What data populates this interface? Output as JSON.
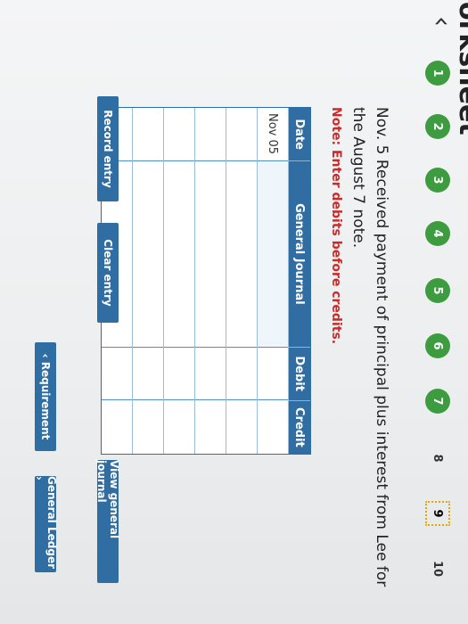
{
  "header": {
    "title": "Worksheet"
  },
  "nav": {
    "prev_icon": "‹",
    "steps": [
      {
        "label": "1",
        "state": "done"
      },
      {
        "label": "2",
        "state": "done"
      },
      {
        "label": "3",
        "state": "done"
      },
      {
        "label": "4",
        "state": "done"
      },
      {
        "label": "5",
        "state": "done"
      },
      {
        "label": "6",
        "state": "done"
      },
      {
        "label": "7",
        "state": "done"
      },
      {
        "label": "8",
        "state": "todo"
      },
      {
        "label": "9",
        "state": "current"
      },
      {
        "label": "10",
        "state": "todo"
      }
    ]
  },
  "question": "Nov. 5 Received payment of principal plus interest from Lee for the August 7 note.",
  "note": "Note: Enter debits before credits.",
  "journal": {
    "headers": {
      "date": "Date",
      "account": "General Journal",
      "debit": "Debit",
      "credit": "Credit"
    },
    "rows": [
      {
        "date": "Nov 05"
      },
      {
        "date": ""
      },
      {
        "date": ""
      },
      {
        "date": ""
      },
      {
        "date": ""
      },
      {
        "date": ""
      }
    ]
  },
  "buttons": {
    "record": "Record entry",
    "clear": "Clear entry",
    "view": "View general journal",
    "requirement": "‹ Requirement",
    "ledger": "General Ledger ›"
  },
  "colors": {
    "accent": "#2f6da3",
    "step_done": "#3d9c3f",
    "note": "#cf2a2a"
  }
}
